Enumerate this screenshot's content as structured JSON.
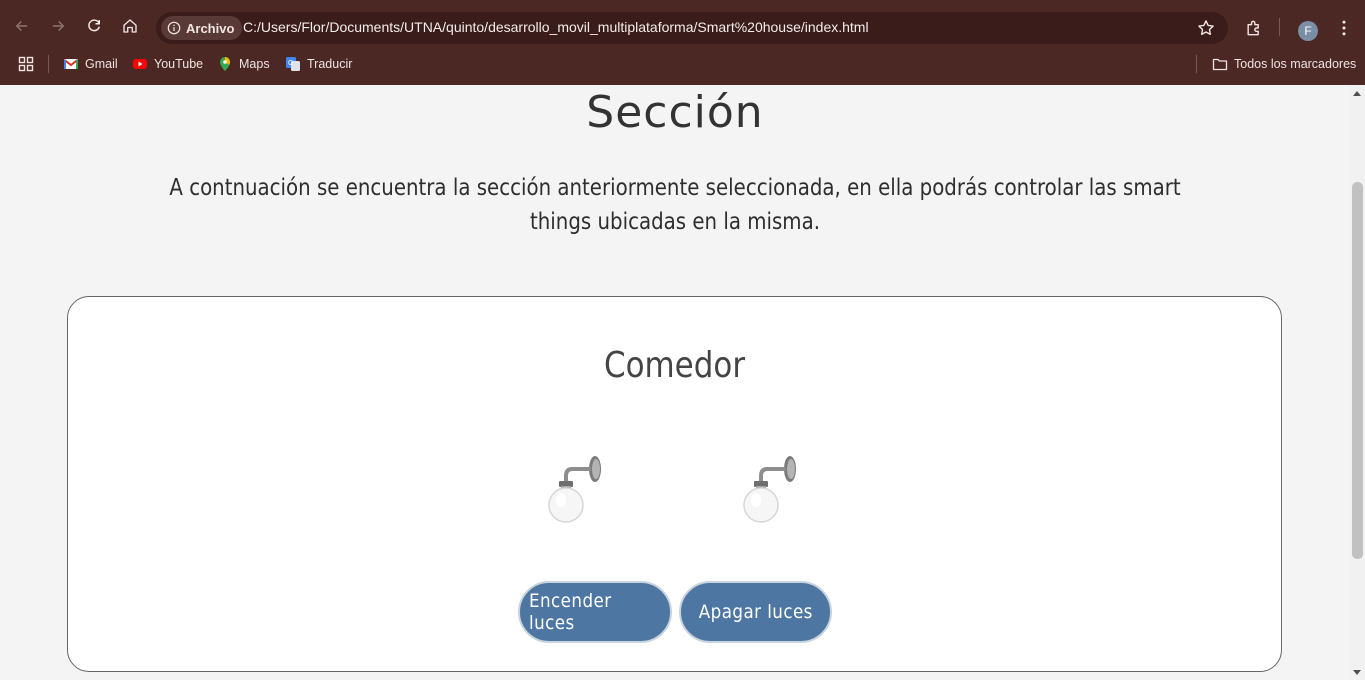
{
  "browser": {
    "security_chip": "Archivo",
    "url": "C:/Users/Flor/Documents/UTNA/quinto/desarrollo_movil_multiplataforma/Smart%20house/index.html",
    "profile_initial": "F",
    "bookmarks": [
      {
        "label": "Gmail",
        "icon": "gmail-icon"
      },
      {
        "label": "YouTube",
        "icon": "youtube-icon"
      },
      {
        "label": "Maps",
        "icon": "maps-icon"
      },
      {
        "label": "Traducir",
        "icon": "translate-icon"
      }
    ],
    "all_bookmarks": "Todos los marcadores"
  },
  "page": {
    "title": "Sección",
    "intro": "A contnuación se encuentra la sección anteriormente seleccionada, en ella podrás controlar las smart things ubicadas en la misma.",
    "room": {
      "title": "Comedor",
      "lamps": [
        {
          "icon": "wall-lamp-icon",
          "state": "off"
        },
        {
          "icon": "wall-lamp-icon",
          "state": "off"
        }
      ],
      "on_button": "Encender luces",
      "off_button": "Apagar luces"
    }
  },
  "colors": {
    "chrome": "#4b2824",
    "omnibox": "#3a1c1a",
    "button": "#4d77a2",
    "page_bg": "#f4f4f4"
  }
}
